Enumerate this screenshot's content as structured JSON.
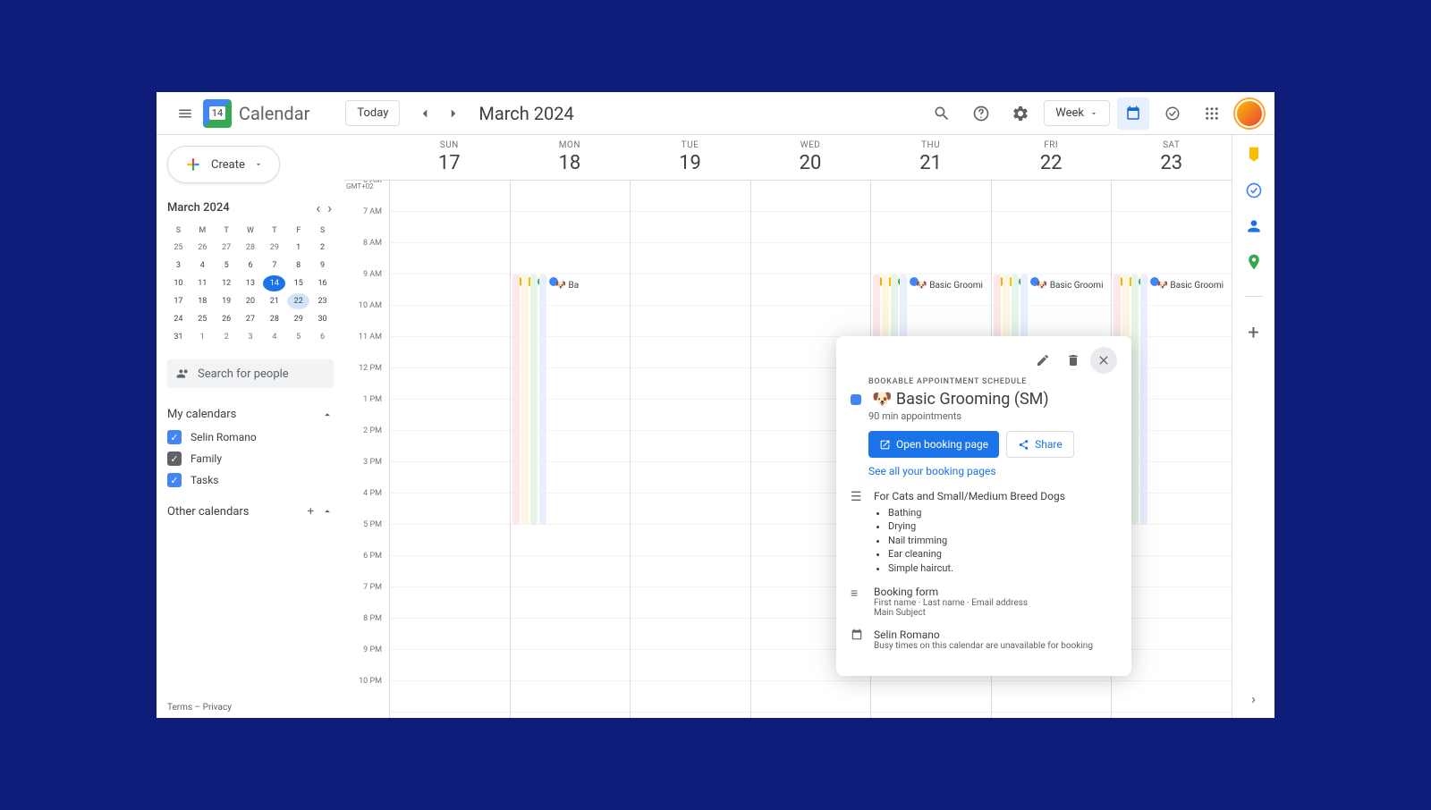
{
  "app": {
    "title": "Calendar",
    "logo_day": "14"
  },
  "header": {
    "today": "Today",
    "month": "March 2024",
    "view": "Week"
  },
  "sidebar": {
    "create": "Create",
    "search": "Search for people",
    "mini_month": "March 2024",
    "dow": [
      "S",
      "M",
      "T",
      "W",
      "T",
      "F",
      "S"
    ],
    "weeks": [
      [
        {
          "d": "25",
          "dim": true
        },
        {
          "d": "26",
          "dim": true
        },
        {
          "d": "27",
          "dim": true
        },
        {
          "d": "28",
          "dim": true
        },
        {
          "d": "29",
          "dim": true
        },
        {
          "d": "1"
        },
        {
          "d": "2"
        }
      ],
      [
        {
          "d": "3"
        },
        {
          "d": "4"
        },
        {
          "d": "5"
        },
        {
          "d": "6"
        },
        {
          "d": "7"
        },
        {
          "d": "8"
        },
        {
          "d": "9"
        }
      ],
      [
        {
          "d": "10"
        },
        {
          "d": "11"
        },
        {
          "d": "12"
        },
        {
          "d": "13"
        },
        {
          "d": "14",
          "current": true
        },
        {
          "d": "15"
        },
        {
          "d": "16"
        }
      ],
      [
        {
          "d": "17"
        },
        {
          "d": "18"
        },
        {
          "d": "19"
        },
        {
          "d": "20"
        },
        {
          "d": "21"
        },
        {
          "d": "22",
          "today": true
        },
        {
          "d": "23"
        }
      ],
      [
        {
          "d": "24"
        },
        {
          "d": "25"
        },
        {
          "d": "26"
        },
        {
          "d": "27"
        },
        {
          "d": "28"
        },
        {
          "d": "29"
        },
        {
          "d": "30"
        }
      ],
      [
        {
          "d": "31"
        },
        {
          "d": "1",
          "dim": true
        },
        {
          "d": "2",
          "dim": true
        },
        {
          "d": "3",
          "dim": true
        },
        {
          "d": "4",
          "dim": true
        },
        {
          "d": "5",
          "dim": true
        },
        {
          "d": "6",
          "dim": true
        }
      ]
    ],
    "my_calendars": "My calendars",
    "calendars": [
      {
        "name": "Selin Romano",
        "color": "blue"
      },
      {
        "name": "Family",
        "color": "gray"
      },
      {
        "name": "Tasks",
        "color": "blue"
      }
    ],
    "other_calendars": "Other calendars"
  },
  "timezone": "GMT+02",
  "days": [
    {
      "dow": "SUN",
      "num": "17"
    },
    {
      "dow": "MON",
      "num": "18"
    },
    {
      "dow": "TUE",
      "num": "19"
    },
    {
      "dow": "WED",
      "num": "20"
    },
    {
      "dow": "THU",
      "num": "21"
    },
    {
      "dow": "FRI",
      "num": "22"
    },
    {
      "dow": "SAT",
      "num": "23"
    }
  ],
  "hours": [
    "6 AM",
    "7 AM",
    "8 AM",
    "9 AM",
    "10 AM",
    "11 AM",
    "12 PM",
    "1 PM",
    "2 PM",
    "3 PM",
    "4 PM",
    "5 PM",
    "6 PM",
    "7 PM",
    "8 PM",
    "9 PM",
    "10 PM"
  ],
  "event_label": "🐶 Basic Groomi",
  "event_label_short": "🐶 Ba",
  "popup": {
    "label": "BOOKABLE APPOINTMENT SCHEDULE",
    "title": "🐶 Basic Grooming (SM)",
    "duration": "90 min appointments",
    "open_btn": "Open booking page",
    "share_btn": "Share",
    "see_all": "See all your booking pages",
    "desc_intro": "For Cats and Small/Medium Breed Dogs",
    "desc_items": [
      "Bathing",
      "Drying",
      "Nail trimming",
      "Ear cleaning",
      "Simple haircut."
    ],
    "form_title": "Booking form",
    "form_fields": "First name · Last name · Email address",
    "form_subject": "Main Subject",
    "owner": "Selin Romano",
    "owner_note": "Busy times on this calendar are unavailable for booking"
  },
  "footer": {
    "terms": "Terms",
    "privacy": "Privacy"
  }
}
